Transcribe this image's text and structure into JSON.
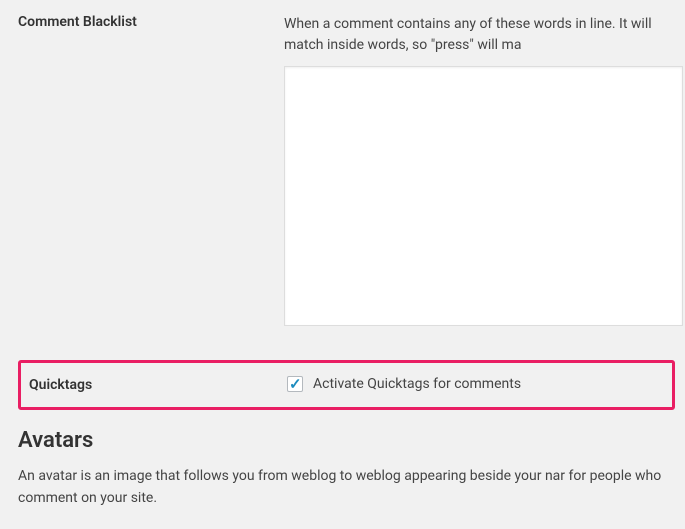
{
  "blacklist": {
    "label": "Comment Blacklist",
    "description": "When a comment contains any of these words in line. It will match inside words, so \"press\" will ma",
    "value": ""
  },
  "quicktags": {
    "label": "Quicktags",
    "checkbox_label": "Activate Quicktags for comments",
    "checked": true
  },
  "avatars": {
    "heading": "Avatars",
    "description": "An avatar is an image that follows you from weblog to weblog appearing beside your nar for people who comment on your site."
  }
}
